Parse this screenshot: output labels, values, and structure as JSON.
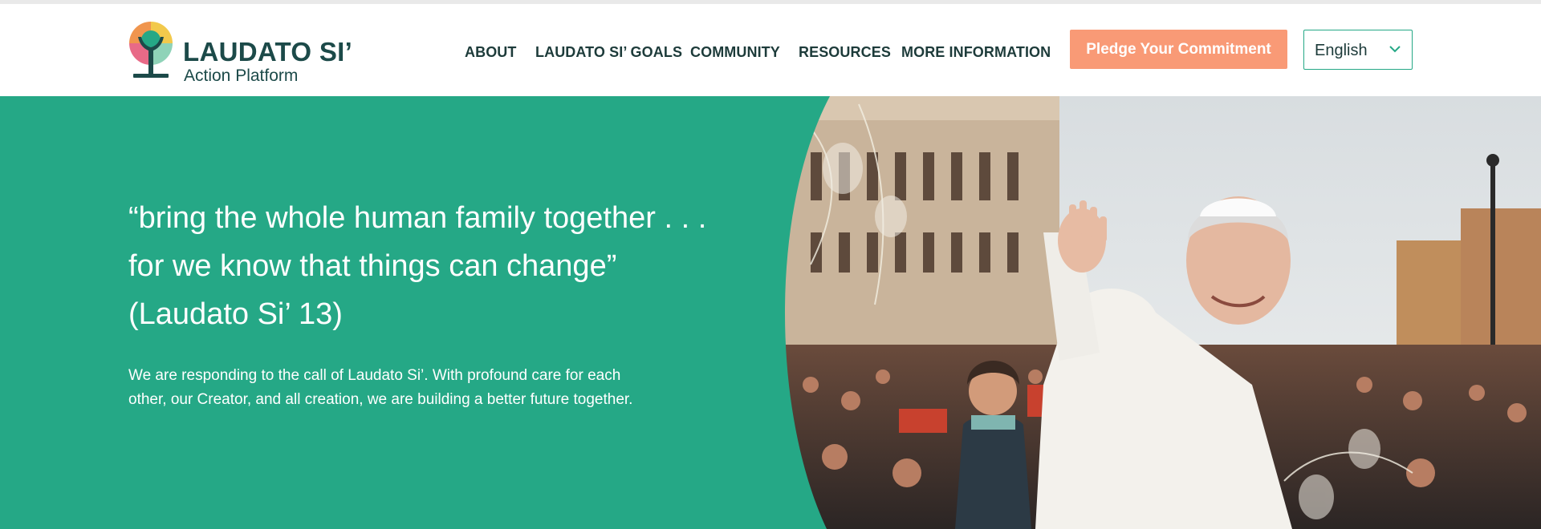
{
  "brand": {
    "name": "LAUDATO SI’",
    "subtitle": "Action Platform",
    "logo_icon": "tree-icon",
    "colors": {
      "dark_teal": "#1c4a49",
      "green": "#25a886",
      "orange": "#f0954e",
      "pink": "#e86a87",
      "yellow": "#f2c94c"
    }
  },
  "nav": {
    "items": [
      {
        "label": "ABOUT"
      },
      {
        "label": "LAUDATO SI’ GOALS"
      },
      {
        "label": "COMMUNITY"
      },
      {
        "label": "RESOURCES"
      },
      {
        "label": "MORE INFORMATION"
      }
    ],
    "pledge_label": "Pledge Your Commitment",
    "pledge_color": "#f99a76",
    "language": {
      "selected": "English",
      "icon": "chevron-down-icon"
    }
  },
  "hero": {
    "background_color": "#25a886",
    "quote_lines": [
      "“bring the whole human family together . . .",
      "for we know that things can change”",
      "(Laudato Si’ 13)"
    ],
    "text": "We are responding to the call of Laudato Si’. With profound care for each other, our Creator, and all creation, we are building a better future together.",
    "photo_icon": "pope-waving-crowd-photo"
  }
}
